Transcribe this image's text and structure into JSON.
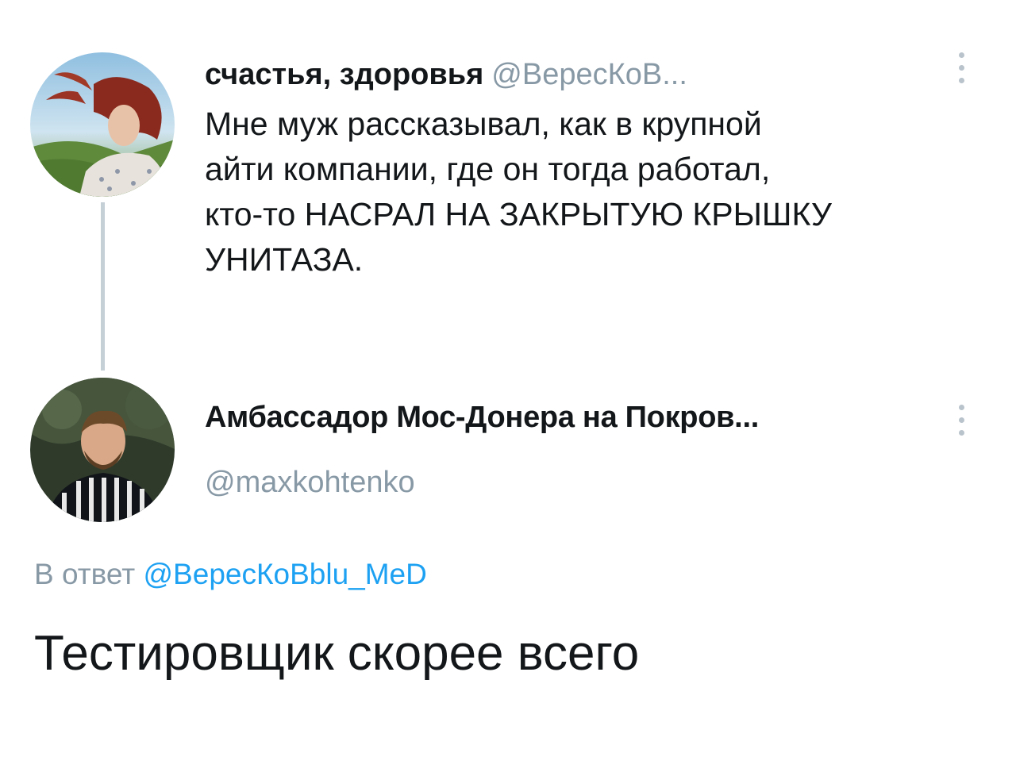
{
  "tweet1": {
    "avatar_icon": "avatar-woman-red-hair",
    "author_name": "счастья, здоровья",
    "author_handle": "@ВересКоВ...",
    "text_lines": [
      "Мне муж рассказывал, как в крупной",
      "айти компании, где он тогда работал,",
      "кто-то НАСРАЛ НА ЗАКРЫТУЮ КРЫШКУ",
      "УНИТАЗА."
    ],
    "more_icon": "more-vertical-icon"
  },
  "tweet2": {
    "avatar_icon": "avatar-man-striped-shirt",
    "author_name": "Амбассадор Мос-Донера на Покров...",
    "author_handle": "@maxkohtenko",
    "reply_prefix": "В ответ",
    "reply_handle": "@ВересКоВblu_MeD",
    "text": "Тестировщик скорее всего",
    "more_icon": "more-vertical-icon"
  },
  "colors": {
    "text": "#14171a",
    "secondary": "#8899a6",
    "link": "#1da1f2",
    "thread_line": "#c4cfd6"
  }
}
